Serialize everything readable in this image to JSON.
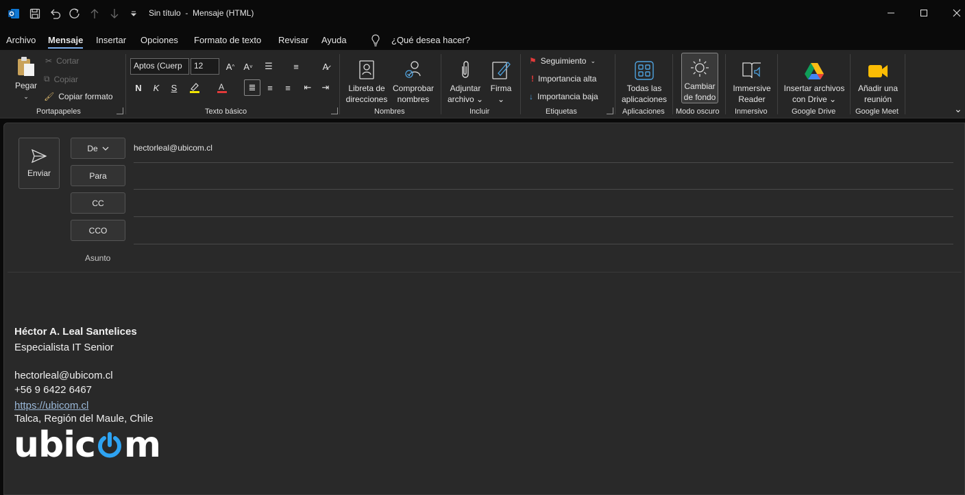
{
  "window": {
    "title": "Sin título  -  Mensaje (HTML)"
  },
  "menu": {
    "tabs": [
      "Archivo",
      "Mensaje",
      "Insertar",
      "Opciones",
      "Formato de texto",
      "Revisar",
      "Ayuda"
    ],
    "active": "Mensaje",
    "search_placeholder": "¿Qué desea hacer?"
  },
  "ribbon": {
    "clipboard": {
      "paste": "Pegar",
      "cut": "Cortar",
      "copy": "Copiar",
      "format_painter": "Copiar formato",
      "label": "Portapapeles"
    },
    "basic_text": {
      "font": "Aptos (Cuerp",
      "size": "12",
      "bold": "N",
      "italic": "K",
      "underline": "S",
      "label": "Texto básico"
    },
    "names": {
      "address_book": [
        "Libreta de",
        "direcciones"
      ],
      "check_names": [
        "Comprobar",
        "nombres"
      ],
      "label": "Nombres"
    },
    "include": {
      "attach": [
        "Adjuntar",
        "archivo"
      ],
      "signature": [
        "Firma"
      ],
      "label": "Incluir"
    },
    "tags": {
      "follow_up": "Seguimiento",
      "high": "Importancia alta",
      "low": "Importancia baja",
      "label": "Etiquetas"
    },
    "apps": {
      "all_apps": [
        "Todas las",
        "aplicaciones"
      ],
      "label": "Aplicaciones"
    },
    "dark_mode": {
      "change_bg": [
        "Cambiar",
        "de fondo"
      ],
      "label": "Modo oscuro"
    },
    "immersive": {
      "reader": [
        "Immersive",
        "Reader"
      ],
      "label": "Inmersivo"
    },
    "google_drive": {
      "insert": [
        "Insertar archivos",
        "con Drive"
      ],
      "label": "Google Drive"
    },
    "google_meet": {
      "add": [
        "Añadir una",
        "reunión"
      ],
      "label": "Google Meet"
    }
  },
  "compose": {
    "send": "Enviar",
    "from_label": "De",
    "from_value": "hectorleal@ubicom.cl",
    "to_label": "Para",
    "cc_label": "CC",
    "bcc_label": "CCO",
    "subject_label": "Asunto"
  },
  "signature": {
    "name": "Héctor A. Leal Santelices",
    "role": "Especialista IT Senior",
    "email": "hectorleal@ubicom.cl",
    "phone": "+56 9 6422 6467",
    "website": "https://ubicom.cl",
    "location": "Talca, Región del Maule, Chile",
    "logo_text": "ubicom"
  },
  "colors": {
    "accent": "#4fa3e0",
    "ribbon_bg": "#262626",
    "compose_bg": "#292929",
    "highlight_yellow": "#f2e600",
    "font_red": "#e23a3a"
  }
}
